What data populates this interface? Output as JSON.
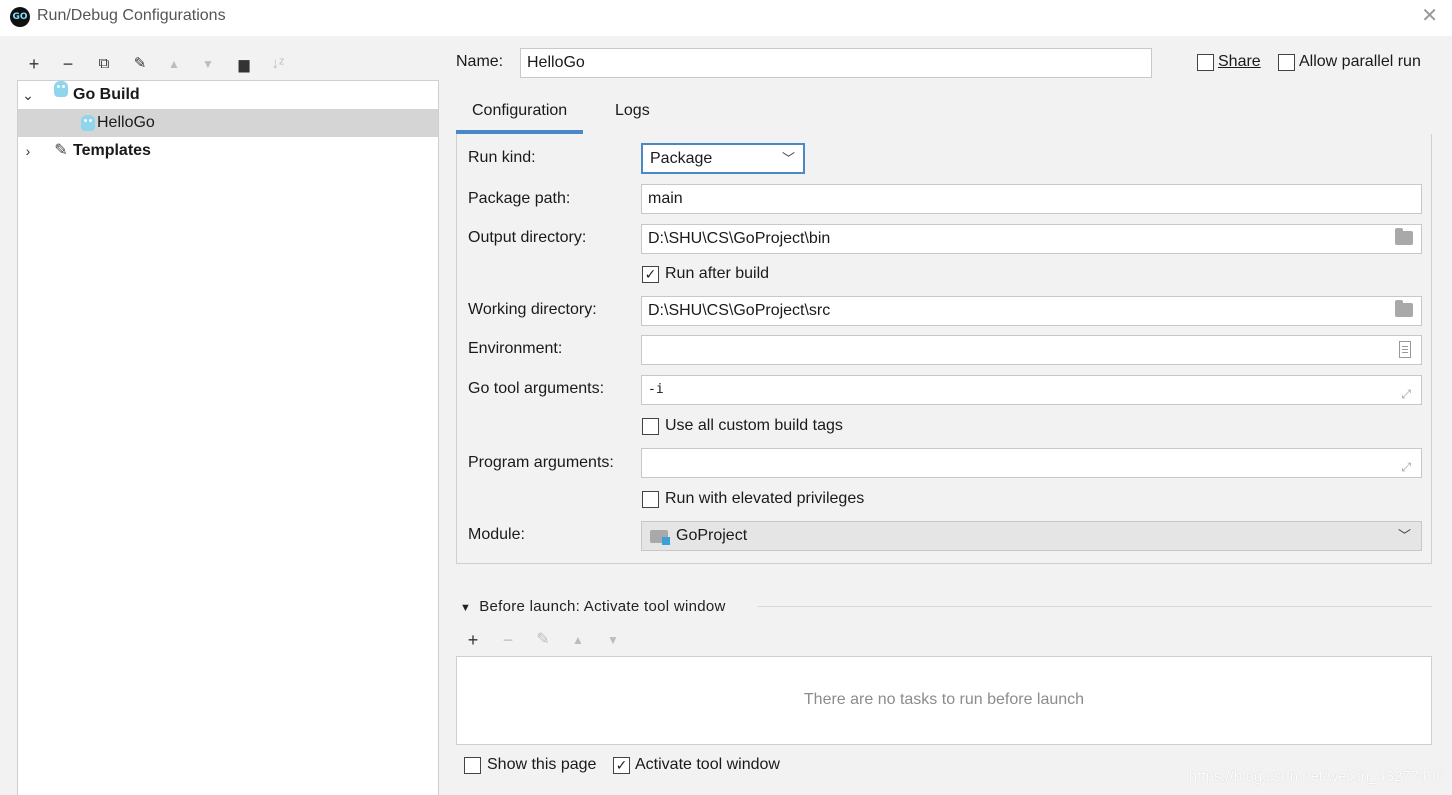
{
  "window": {
    "title": "Run/Debug Configurations",
    "app_icon": "go-logo-icon",
    "close_icon": "close-icon"
  },
  "left": {
    "toolbar": [
      {
        "name": "add-icon",
        "glyph": "+",
        "enabled": true
      },
      {
        "name": "remove-icon",
        "glyph": "−",
        "enabled": true
      },
      {
        "name": "copy-icon",
        "glyph": "⧉",
        "enabled": true
      },
      {
        "name": "wrench-icon",
        "glyph": "🔧",
        "enabled": true
      },
      {
        "name": "move-up-icon",
        "glyph": "▲",
        "enabled": false
      },
      {
        "name": "move-down-icon",
        "glyph": "▼",
        "enabled": false
      },
      {
        "name": "new-folder-icon",
        "glyph": "▆",
        "enabled": true
      },
      {
        "name": "sort-icon",
        "glyph": "↓",
        "enabled": false
      }
    ],
    "tree": {
      "group_label": "Go Build",
      "item_label": "HelloGo",
      "templates_label": "Templates"
    }
  },
  "right": {
    "name_label": "Name:",
    "name_value": "HelloGo",
    "share_label": "Share",
    "parallel_label": "Allow parallel run",
    "tabs": [
      "Configuration",
      "Logs"
    ],
    "run_kind_label": "Run kind:",
    "run_kind_value": "Package",
    "package_path_label": "Package path:",
    "package_path_value": "main",
    "output_dir_label": "Output directory:",
    "output_dir_value": "D:\\SHU\\CS\\GoProject\\bin",
    "run_after_build_label": "Run after build",
    "run_after_build_checked": true,
    "working_dir_label": "Working directory:",
    "working_dir_value": "D:\\SHU\\CS\\GoProject\\src",
    "environment_label": "Environment:",
    "environment_value": "",
    "go_tool_args_label": "Go tool arguments:",
    "go_tool_args_value": "-i",
    "custom_tags_label": "Use all custom build tags",
    "custom_tags_checked": false,
    "program_args_label": "Program arguments:",
    "program_args_value": "",
    "elevated_label": "Run with elevated privileges",
    "elevated_checked": false,
    "module_label": "Module:",
    "module_value": "GoProject",
    "before_launch_title": "Before launch: Activate tool window",
    "tasks_empty_text": "There are no tasks to run before launch",
    "show_page_label": "Show this page",
    "show_page_checked": false,
    "activate_window_label": "Activate tool window",
    "activate_window_checked": true
  },
  "watermark": "https://blog.csdn.net/weixin_43277406"
}
